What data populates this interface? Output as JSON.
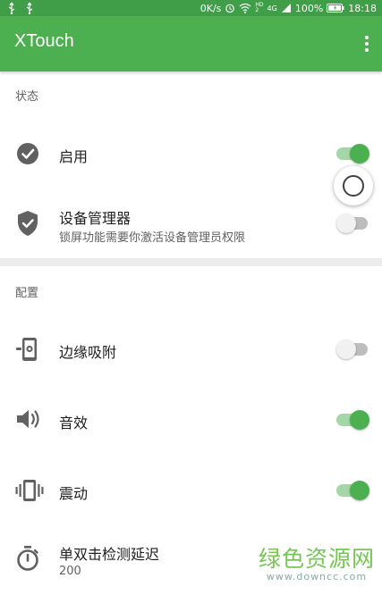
{
  "status_bar": {
    "net_speed": "0K/s",
    "hd_label_top": "HD",
    "hd_label_bottom": "2",
    "signal_label": "4G",
    "battery": "100%",
    "time": "18:18"
  },
  "app_bar": {
    "title": "XTouch",
    "overflow_icon": "more-vert-icon"
  },
  "colors": {
    "status_bar": "#3f9e47",
    "app_bar": "#4caf50",
    "switch_on": "#4caf50",
    "switch_on_track": "#a5d6a7",
    "switch_off_track": "#bdbdbd",
    "watermark": "#6cbf4a"
  },
  "sections": {
    "status": {
      "header": "状态",
      "items": {
        "enable": {
          "title": "启用",
          "icon": "check-circle-icon",
          "toggle": "on"
        },
        "device_admin": {
          "title": "设备管理器",
          "subtitle": "锁屏功能需要你激活设备管理员权限",
          "icon": "shield-check-icon",
          "toggle": "off"
        }
      }
    },
    "config": {
      "header": "配置",
      "items": {
        "edge_snap": {
          "title": "边缘吸附",
          "icon": "phone-settings-icon",
          "toggle": "off"
        },
        "sound": {
          "title": "音效",
          "icon": "volume-icon",
          "toggle": "on"
        },
        "vibrate": {
          "title": "震动",
          "icon": "vibration-icon",
          "toggle": "on"
        },
        "double_tap_delay": {
          "title": "单双击检测延迟",
          "subtitle": "200",
          "icon": "timer-icon"
        }
      }
    }
  },
  "floating_button": {
    "icon": "ring-icon"
  },
  "watermark": {
    "main": "绿色资源网",
    "sub": "www.downcc.com"
  }
}
